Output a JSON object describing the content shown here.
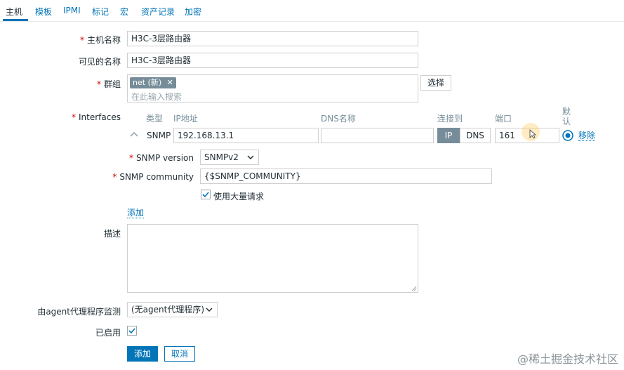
{
  "tabs": [
    {
      "label": "主机"
    },
    {
      "label": "模板"
    },
    {
      "label": "IPMI"
    },
    {
      "label": "标记"
    },
    {
      "label": "宏"
    },
    {
      "label": "资产记录"
    },
    {
      "label": "加密"
    }
  ],
  "form": {
    "host_name_label": "主机名称",
    "host_name_value": "H3C-3层路由器",
    "visible_name_label": "可见的名称",
    "visible_name_value": "H3C-3层路由器",
    "groups_label": "群组",
    "group_chip": "net (新)",
    "groups_placeholder": "在此输入搜索",
    "select_button": "选择",
    "interfaces_label": "Interfaces",
    "required_mark": "*"
  },
  "interfaces": {
    "headers": {
      "type": "类型",
      "ip": "IP地址",
      "dns": "DNS名称",
      "connect": "连接到",
      "port": "端口",
      "default": "默认"
    },
    "row": {
      "type": "SNMP",
      "ip": "192.168.13.1",
      "dns": "",
      "connect_ip": "IP",
      "connect_dns": "DNS",
      "port": "161",
      "remove": "移除"
    },
    "snmp_version_label": "SNMP version",
    "snmp_version_value": "SNMPv2",
    "snmp_community_label": "SNMP community",
    "snmp_community_value": "{$SNMP_COMMUNITY}",
    "bulk_label": "使用大量请求",
    "add_link": "添加"
  },
  "description": {
    "label": "描述",
    "value": ""
  },
  "agent_proxy": {
    "label": "由agent代理程序监测",
    "value": "(无agent代理程序)"
  },
  "enabled": {
    "label": "已启用"
  },
  "actions": {
    "add": "添加",
    "cancel": "取消"
  },
  "watermark": "@稀土掘金技术社区",
  "colors": {
    "accent": "#0275b8",
    "chip": "#768d99",
    "required": "#d40000"
  }
}
